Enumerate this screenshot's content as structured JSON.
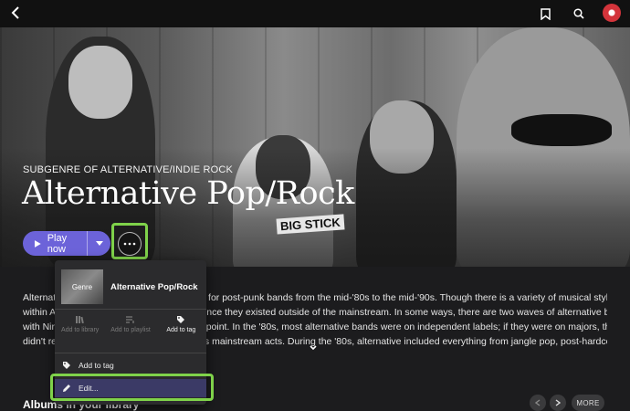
{
  "topbar": {
    "back_icon": "chevron-left-icon",
    "bookmark_icon": "bookmark-icon",
    "search_icon": "search-icon",
    "avatar_icon": "user-avatar"
  },
  "hero": {
    "subtitle": "SUBGENRE OF ALTERNATIVE/INDIE ROCK",
    "title": "Alternative Pop/Rock",
    "shirt_text": "BIG STICK",
    "play_label": "Play now",
    "accent_color": "#6c63d9"
  },
  "description": {
    "lines": [
      "Alternat                                                    rm for post-punk bands from the mid-'80s to the mid-'90s. Though there is a variety of musical styles",
      "within A                                                  er since they existed outside of the mainstream. In some ways, there are two waves of alternative bands,",
      "with Nir                                                   ing point. In the '80s, most alternative bands were on independent labels; if they were on majors, they",
      "didn't re                                                  bel's mainstream acts. During the '80s, alternative included everything from jangle pop, post-hardcore"
    ]
  },
  "albums": {
    "heading": "Albums in your library",
    "more_label": "MORE"
  },
  "menu": {
    "thumb_label": "Genre",
    "name": "Alternative Pop/Rock",
    "actions": [
      {
        "label": "Add to library",
        "icon": "library-icon",
        "enabled": false
      },
      {
        "label": "Add to playlist",
        "icon": "playlist-icon",
        "enabled": false
      },
      {
        "label": "Add to tag",
        "icon": "tag-icon",
        "enabled": true
      }
    ],
    "items": [
      {
        "label": "Add to tag",
        "icon": "tag-icon"
      },
      {
        "label": "Edit...",
        "icon": "pencil-icon"
      }
    ]
  },
  "highlight_color": "#7fd24a"
}
